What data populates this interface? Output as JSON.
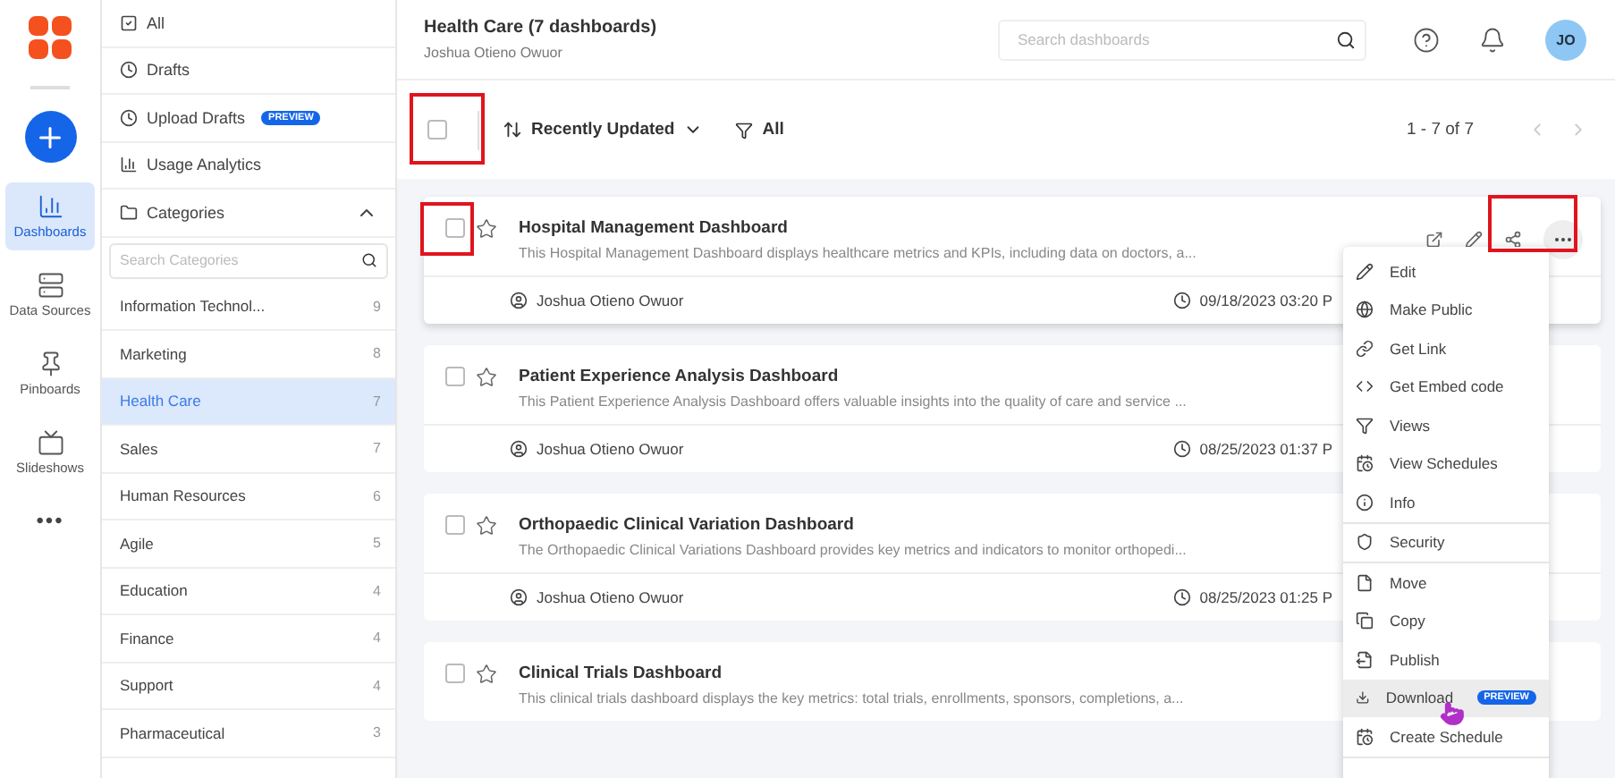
{
  "rail": {
    "items": [
      {
        "label": "Dashboards",
        "selected": true
      },
      {
        "label": "Data Sources",
        "selected": false
      },
      {
        "label": "Pinboards",
        "selected": false
      },
      {
        "label": "Slideshows",
        "selected": false
      }
    ],
    "more": "•••"
  },
  "nav": {
    "items": [
      {
        "label": "All"
      },
      {
        "label": "Drafts"
      },
      {
        "label": "Upload Drafts",
        "badge": "PREVIEW"
      },
      {
        "label": "Usage Analytics"
      }
    ],
    "categories": {
      "label": "Categories",
      "expanded": true,
      "search_placeholder": "Search Categories",
      "items": [
        {
          "name": "Information Technol...",
          "count": "9",
          "selected": false
        },
        {
          "name": "Marketing",
          "count": "8",
          "selected": false
        },
        {
          "name": "Health Care",
          "count": "7",
          "selected": true
        },
        {
          "name": "Sales",
          "count": "7",
          "selected": false
        },
        {
          "name": "Human Resources",
          "count": "6",
          "selected": false
        },
        {
          "name": "Agile",
          "count": "5",
          "selected": false
        },
        {
          "name": "Education",
          "count": "4",
          "selected": false
        },
        {
          "name": "Finance",
          "count": "4",
          "selected": false
        },
        {
          "name": "Support",
          "count": "4",
          "selected": false
        },
        {
          "name": "Pharmaceutical",
          "count": "3",
          "selected": false
        }
      ]
    }
  },
  "header": {
    "title": "Health Care (7 dashboards)",
    "subtitle": "Joshua Otieno Owuor",
    "search_placeholder": "Search dashboards",
    "avatar": "JO"
  },
  "toolbar": {
    "select_all_checked": false,
    "sort": "Recently Updated",
    "filter": "All",
    "pagination": "1 - 7 of 7"
  },
  "dashboards": [
    {
      "title": "Hospital Management Dashboard",
      "description": "This Hospital Management Dashboard displays healthcare metrics and KPIs, including data on doctors, a...",
      "owner": "Joshua Otieno Owuor",
      "date": "09/18/2023 03:20 P",
      "checked": false,
      "hovered": true
    },
    {
      "title": "Patient Experience Analysis Dashboard",
      "description": "This Patient Experience Analysis Dashboard offers valuable insights into the quality of care and service ...",
      "owner": "Joshua Otieno Owuor",
      "date": "08/25/2023 01:37 P",
      "checked": false,
      "hovered": false
    },
    {
      "title": "Orthopaedic Clinical Variation Dashboard",
      "description": "The Orthopaedic Clinical Variations Dashboard provides key metrics and indicators to monitor orthopedi...",
      "owner": "Joshua Otieno Owuor",
      "date": "08/25/2023 01:25 P",
      "checked": false,
      "hovered": false
    },
    {
      "title": "Clinical Trials Dashboard",
      "description": "This clinical trials dashboard displays the key metrics: total trials, enrollments, sponsors, completions, a...",
      "checked": false,
      "hovered": false
    }
  ],
  "menu": {
    "sections": [
      [
        {
          "label": "Edit",
          "hovered": false
        },
        {
          "label": "Make Public",
          "hovered": false
        },
        {
          "label": "Get Link",
          "hovered": false
        },
        {
          "label": "Get Embed code",
          "hovered": false
        },
        {
          "label": "Views",
          "hovered": false
        },
        {
          "label": "View Schedules",
          "hovered": false
        },
        {
          "label": "Info",
          "hovered": false
        }
      ],
      [
        {
          "label": "Security",
          "hovered": false
        }
      ],
      [
        {
          "label": "Move",
          "hovered": false
        },
        {
          "label": "Copy",
          "hovered": false
        },
        {
          "label": "Publish",
          "hovered": false
        },
        {
          "label": "Download",
          "hovered": true,
          "badge": "PREVIEW"
        },
        {
          "label": "Create Schedule",
          "hovered": false
        }
      ]
    ]
  }
}
